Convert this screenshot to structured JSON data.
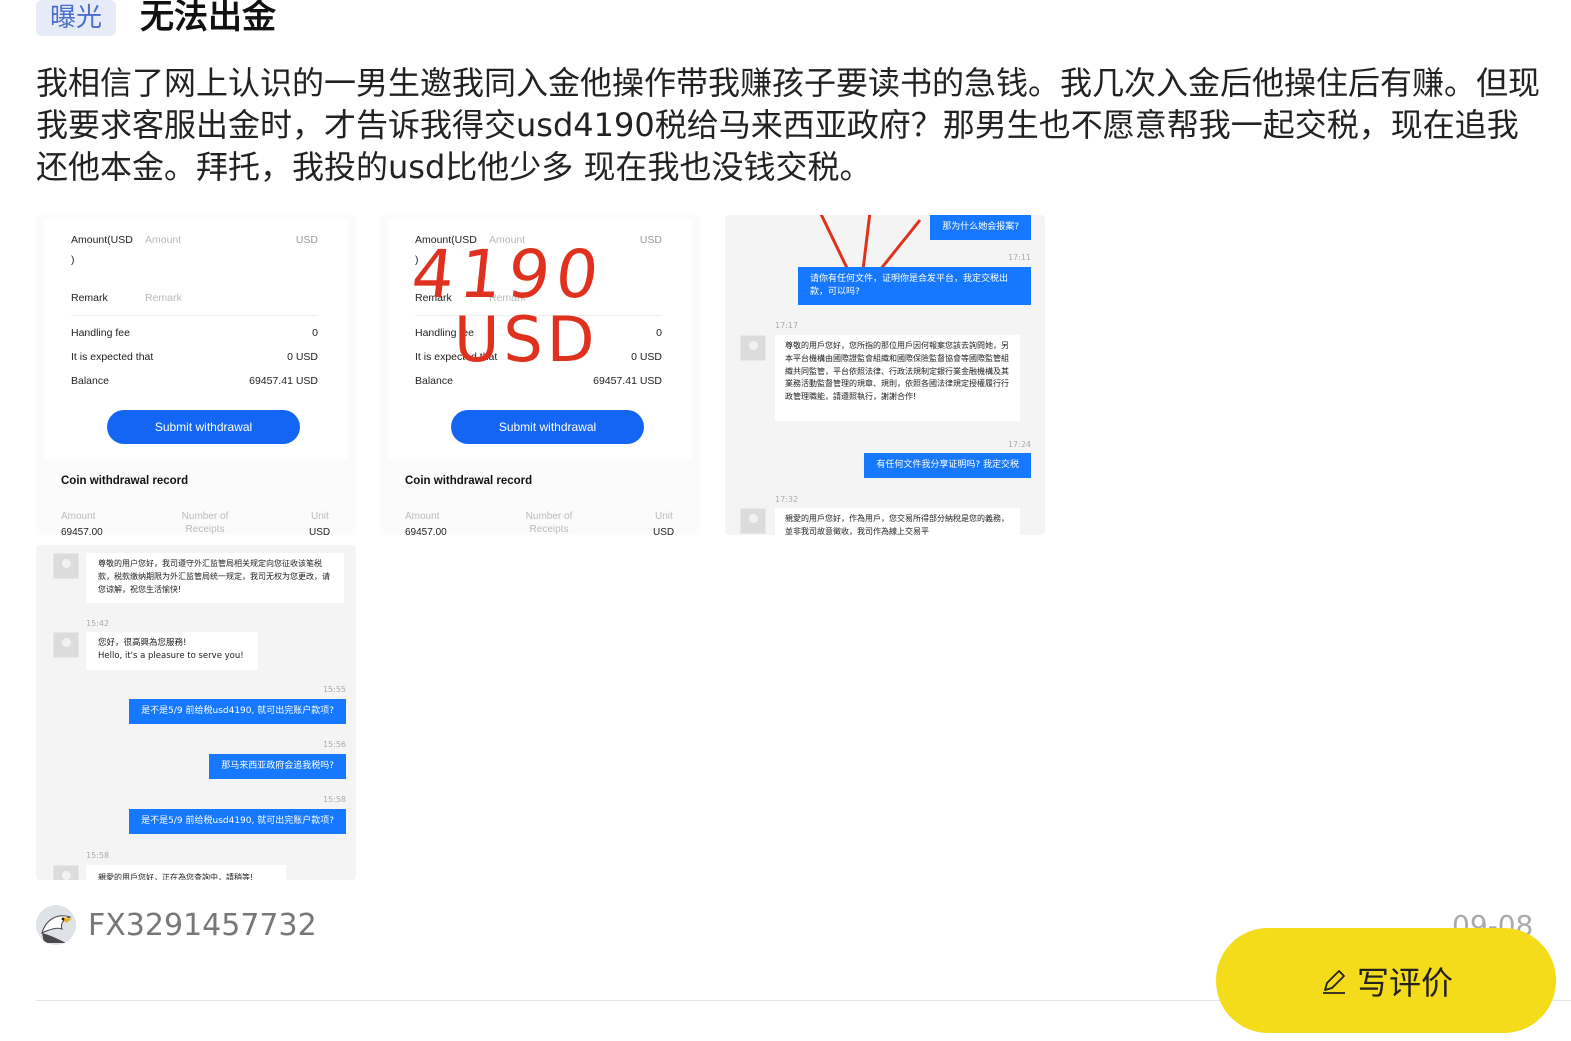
{
  "post": {
    "tag": "曝光",
    "title": "无法出金",
    "body": "我相信了网上认识的一男生邀我同入金他操作带我赚孩子要读书的急钱。我几次入金后他操住后有赚。但现我要求客服出金时，才告诉我得交usd4190税给马来西亚政府？那男生也不愿意帮我一起交税，现在追我还他本金。拜托，我投的usd比他少多 现在我也没钱交税。"
  },
  "withdraw_form": {
    "amount_label": "Amount(USD",
    "amount_label_tail": ")",
    "amount_placeholder": "Amount",
    "amount_unit": "USD",
    "remark_label": "Remark",
    "remark_placeholder": "Remark",
    "fee_label": "Handling fee",
    "fee_value": "0",
    "expected_label": "It is expected that",
    "expected_value": "0 USD",
    "balance_label": "Balance",
    "balance_value": "69457.41 USD",
    "submit_label": "Submit withdrawal",
    "record_title": "Coin withdrawal record",
    "col_amount": "Amount",
    "col_receipts": "Number of Receipts",
    "col_unit": "Unit",
    "row_amount": "69457.00",
    "row_unit": "USD"
  },
  "annotation": {
    "line1": "4190",
    "line2": "USD",
    "color": "#e0301e"
  },
  "chat1": {
    "msg1": "那为什么她会报案?",
    "time1": "17:11",
    "msg2": "请你有任何文件，证明你是合发平台，我定交税出款，可以吗?",
    "time2": "17:17",
    "msg3": "尊敬的用戶您好，您所指的那位用戶因何報案您該去詢問她，另本平台機構由國際證監會組織和國際保險監督協會等國際監管組織共同監管，平台依照法律、行政法規制定銀行業金融機構及其業務活動監督管理的規章、規則，依照各國法律規定授權履行行政管理職能，請遵照執行，謝謝合作!",
    "time3": "17:24",
    "msg4": "有任何文件我分享证明吗? 我定交税",
    "time4": "17:32",
    "msg5": "親愛的用戶您好，作為用戶，您交易所得部分納稅是您的義務，並非我司故意徵收，我司作為線上交易平"
  },
  "chat2": {
    "msg1": "尊敬的用户您好，我司遵守外汇监管局相关规定向您征收该笔税款，税款缴纳期限为外汇监管局统一规定，我司无权为您更改，请您谅解，祝您生活愉快!",
    "time1": "15:42",
    "msg2a": "您好，很高興為您服務!",
    "msg2b": "Hello, it's a pleasure to serve you!",
    "time2": "15:55",
    "msg3": "是不是5/9 前给税usd4190, 就可出完账户款项?",
    "time3": "15:56",
    "msg4": "那马来西亚政府会追我税吗?",
    "time4": "15:58",
    "msg5": "是不是5/9 前给税usd4190, 就可出完账户款项?",
    "time5": "15:58",
    "msg6": "親愛的用戶您好，正在為您查詢中，請稍等!"
  },
  "footer": {
    "username": "FX3291457732",
    "date": "09-08",
    "review_label": "写评价",
    "review_color": "#f5dc1a"
  }
}
